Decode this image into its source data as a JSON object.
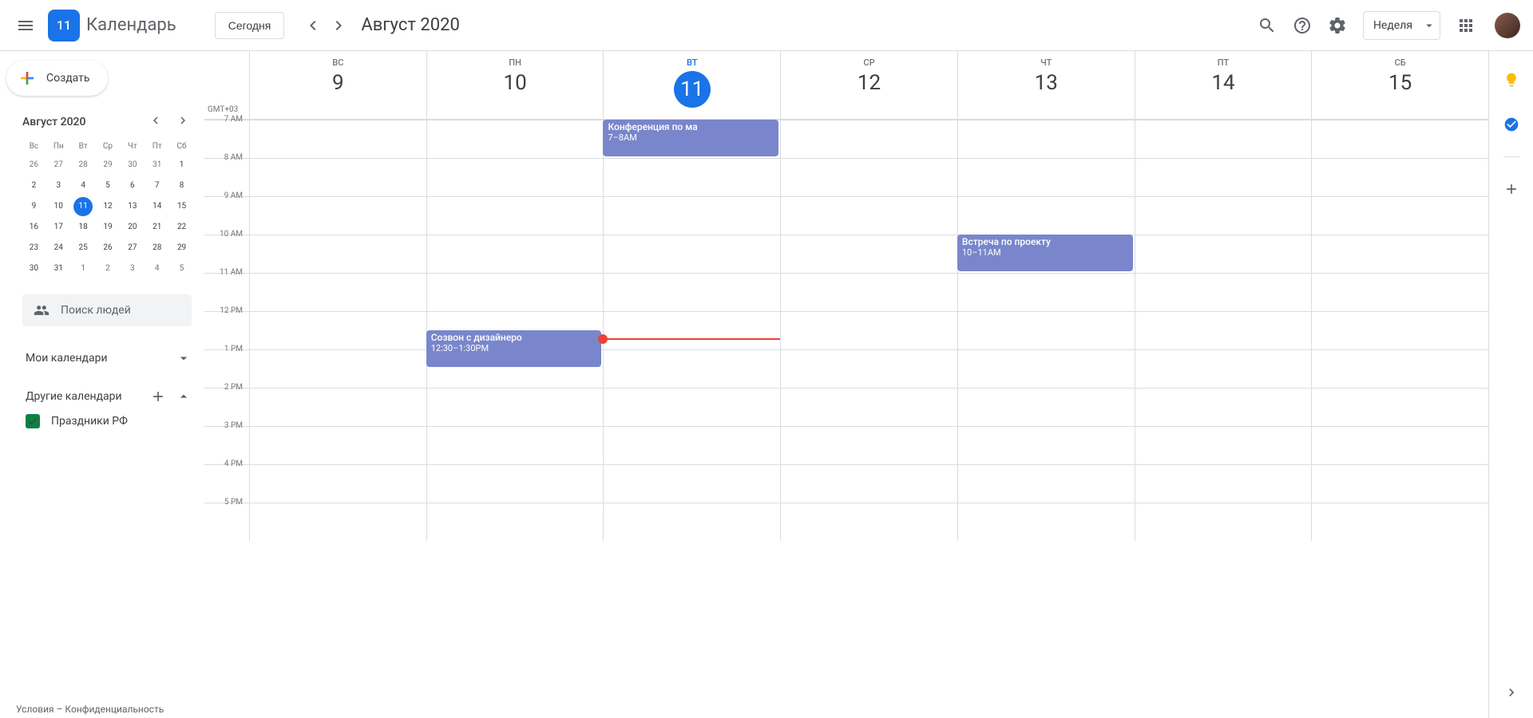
{
  "header": {
    "logo_day": "11",
    "app_title": "Календарь",
    "today_label": "Сегодня",
    "date_range": "Август 2020",
    "view_label": "Неделя"
  },
  "sidebar": {
    "create_label": "Создать",
    "mini_cal": {
      "title": "Август 2020",
      "dow": [
        "Вс",
        "Пн",
        "Вт",
        "Ср",
        "Чт",
        "Пт",
        "Сб"
      ],
      "weeks": [
        [
          {
            "d": 26,
            "o": true
          },
          {
            "d": 27,
            "o": true
          },
          {
            "d": 28,
            "o": true
          },
          {
            "d": 29,
            "o": true
          },
          {
            "d": 30,
            "o": true
          },
          {
            "d": 31,
            "o": true
          },
          {
            "d": 1
          }
        ],
        [
          {
            "d": 2
          },
          {
            "d": 3
          },
          {
            "d": 4
          },
          {
            "d": 5
          },
          {
            "d": 6
          },
          {
            "d": 7
          },
          {
            "d": 8
          }
        ],
        [
          {
            "d": 9
          },
          {
            "d": 10
          },
          {
            "d": 11,
            "t": true
          },
          {
            "d": 12
          },
          {
            "d": 13
          },
          {
            "d": 14
          },
          {
            "d": 15
          }
        ],
        [
          {
            "d": 16
          },
          {
            "d": 17
          },
          {
            "d": 18
          },
          {
            "d": 19
          },
          {
            "d": 20
          },
          {
            "d": 21
          },
          {
            "d": 22
          }
        ],
        [
          {
            "d": 23
          },
          {
            "d": 24
          },
          {
            "d": 25
          },
          {
            "d": 26
          },
          {
            "d": 27
          },
          {
            "d": 28
          },
          {
            "d": 29
          }
        ],
        [
          {
            "d": 30
          },
          {
            "d": 31
          },
          {
            "d": 1,
            "o": true
          },
          {
            "d": 2,
            "o": true
          },
          {
            "d": 3,
            "o": true
          },
          {
            "d": 4,
            "o": true
          },
          {
            "d": 5,
            "o": true
          }
        ]
      ]
    },
    "search_people": "Поиск людей",
    "my_calendars": "Мои календари",
    "other_calendars": "Другие календари",
    "holidays_rf": "Праздники РФ",
    "footer": "Условия – Конфиденциальность"
  },
  "week": {
    "tz": "GMT+03",
    "days": [
      {
        "dow": "ВС",
        "num": "9",
        "today": false
      },
      {
        "dow": "ПН",
        "num": "10",
        "today": false
      },
      {
        "dow": "ВТ",
        "num": "11",
        "today": true
      },
      {
        "dow": "СР",
        "num": "12",
        "today": false
      },
      {
        "dow": "ЧТ",
        "num": "13",
        "today": false
      },
      {
        "dow": "ПТ",
        "num": "14",
        "today": false
      },
      {
        "dow": "СБ",
        "num": "15",
        "today": false
      }
    ],
    "hours": [
      "7 AM",
      "8 AM",
      "9 AM",
      "10 AM",
      "11 AM",
      "12 PM",
      "1 PM",
      "2 PM",
      "3 PM",
      "4 PM",
      "5 PM"
    ],
    "currentTime": {
      "col": 2,
      "offsetMin": 342
    },
    "events": [
      {
        "col": 2,
        "startMin": 0,
        "durMin": 60,
        "title": "Конференция по ма",
        "time": "7–8AM"
      },
      {
        "col": 4,
        "startMin": 180,
        "durMin": 60,
        "title": "Встреча по проекту",
        "time": "10–11AM"
      },
      {
        "col": 1,
        "startMin": 330,
        "durMin": 60,
        "title": "Созвон с дизайнеро",
        "time": "12:30–1:30PM"
      }
    ]
  }
}
